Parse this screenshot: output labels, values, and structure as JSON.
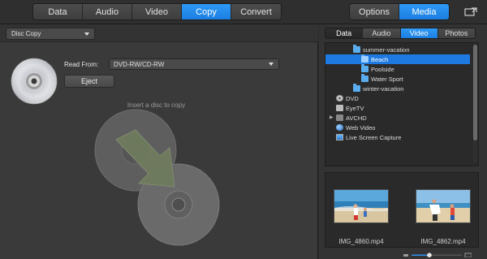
{
  "top_tabs": [
    {
      "label": "Data",
      "active": false
    },
    {
      "label": "Audio",
      "active": false
    },
    {
      "label": "Video",
      "active": false
    },
    {
      "label": "Copy",
      "active": true
    },
    {
      "label": "Convert",
      "active": false
    }
  ],
  "side_tabs": [
    {
      "label": "Options",
      "active": false
    },
    {
      "label": "Media",
      "active": true
    }
  ],
  "copy_panel": {
    "mode_select": "Disc Copy",
    "read_from_label": "Read From:",
    "drive_select": "DVD-RW/CD-RW",
    "eject_label": "Eject",
    "insert_hint": "Insert a disc to copy"
  },
  "media_tabs": [
    {
      "label": "Data",
      "state": "selected"
    },
    {
      "label": "Audio",
      "state": "normal"
    },
    {
      "label": "Video",
      "state": "active"
    },
    {
      "label": "Photos",
      "state": "normal"
    }
  ],
  "tree": {
    "items": [
      {
        "label": "summer-vacation",
        "icon": "folder-icon",
        "selected": false
      },
      {
        "label": "Beach",
        "icon": "folder-icon",
        "selected": true
      },
      {
        "label": "Poolside",
        "icon": "folder-icon",
        "selected": false
      },
      {
        "label": "Water Sport",
        "icon": "folder-icon",
        "selected": false
      },
      {
        "label": "winter-vacation",
        "icon": "folder-icon",
        "selected": false
      },
      {
        "label": "DVD",
        "icon": "disc-icon",
        "selected": false
      },
      {
        "label": "EyeTV",
        "icon": "tv-icon",
        "selected": false
      },
      {
        "label": "AVCHD",
        "icon": "camera-icon",
        "selected": false
      },
      {
        "label": "Web Video",
        "icon": "globe-icon",
        "selected": false
      },
      {
        "label": "Live Screen Capture",
        "icon": "screen-icon",
        "selected": false
      }
    ]
  },
  "media_files": [
    {
      "name": "IMG_4860.mp4"
    },
    {
      "name": "IMG_4862.mp4"
    }
  ],
  "colors": {
    "accent": "#1e7ae0",
    "panel": "#3a3a3a",
    "background": "#2b2b2b"
  }
}
